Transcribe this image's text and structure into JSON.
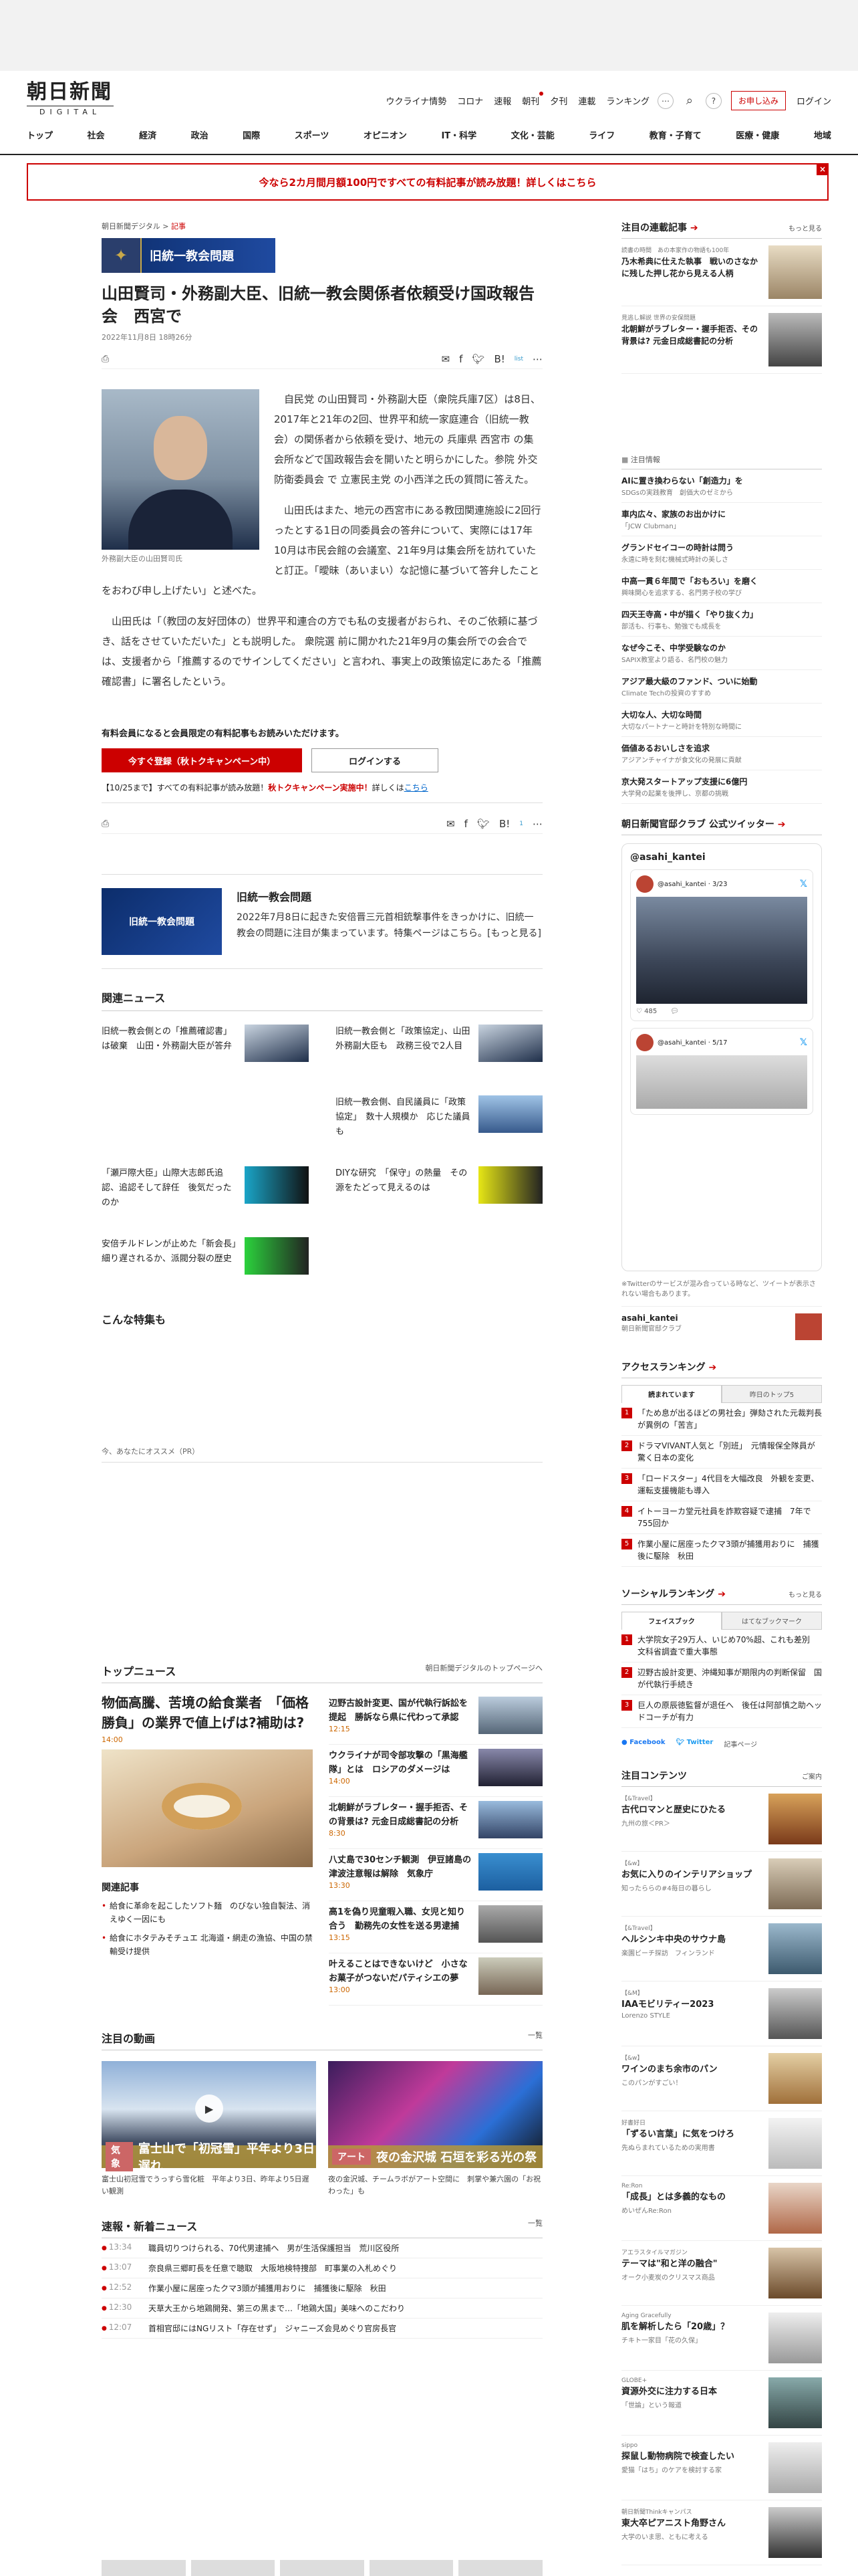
{
  "header": {
    "logo_main": "朝日新聞",
    "logo_sub": "DIGITAL",
    "subnav": [
      "ウクライナ情勢",
      "コロナ",
      "速報",
      "朝刊",
      "夕刊",
      "連載",
      "ランキング"
    ],
    "subscribe": "お申し込み",
    "login": "ログイン",
    "mainnav": [
      "トップ",
      "社会",
      "経済",
      "政治",
      "国際",
      "スポーツ",
      "オピニオン",
      "IT・科学",
      "文化・芸能",
      "ライフ",
      "教育・子育て",
      "医療・健康",
      "地域"
    ]
  },
  "promo": {
    "text": "今なら2カ月間月額100円ですべての有料記事が読み放題！詳しくはこちら",
    "close": "×"
  },
  "article": {
    "crumb_site": "朝日新聞デジタル",
    "crumb_sep": ">",
    "crumb_section": "記事",
    "feature_label": "旧統一教会問題",
    "title": "山田賢司・外務副大臣、旧統一教会関係者依頼受け国政報告会　西宮で",
    "date": "2022年11月8日 18時26分",
    "photo_caption": "外務副大臣の山田賢司氏",
    "paragraphs": [
      "自民党 の山田賢司・外務副大臣（衆院兵庫7区）は8日、2017年と21年の2回、世界平和統一家庭連合（旧統一教会）の関係者から依頼を受け、地元の 兵庫県 西宮市 の集会所などで国政報告会を開いたと明らかにした。参院 外交防衛委員会 で 立憲民主党 の小西洋之氏の質問に答えた。",
      "山田氏はまた、地元の西宮市にある教団関連施設に2回行ったとする1日の同委員会の答弁について、実際には17年10月は市民会館の会議室、21年9月は集会所を訪れていたと訂正。「曖昧（あいまい）な記憶に基づいて答弁したことをおわび申し上げたい」と述べた。",
      "山田氏は「（教団の友好団体の）世界平和連合の方でも私の支援者がおられ、そのご依頼に基づき、話をさせていただいた」とも説明した。 衆院選 前に開かれた21年9月の集会所での会合では、支援者から「推薦するのでサインしてください」と言われ、事実上の政策協定にあたる「推薦確認書」に署名したという。"
    ],
    "paywall_note": "有料会員になると会員限定の有料記事もお読みいただけます。",
    "register_btn": "今すぐ登録（秋トクキャンペーン中）",
    "login_btn": "ログインする",
    "campaign_pre": "【10/25まで】すべての有料記事が読み放題！",
    "campaign_red": "秋トクキャンペーン実施中！",
    "campaign_mid": "詳しくは",
    "campaign_link": "こちら",
    "share_small": "list",
    "share_count": "1"
  },
  "feature_box": {
    "img_label": "旧統一教会問題",
    "title": "旧統一教会問題",
    "text": "2022年7月8日に起きた安倍晋三元首相銃撃事件をきっかけに、旧統一教会の問題に注目が集まっています。特集ページはこちら。[もっと見る]"
  },
  "related": {
    "heading": "関連ニュース",
    "items": [
      "旧統一教会側との「推薦確認書」は破棄　山田・外務副大臣が答弁",
      "旧統一教会側と「政策協定」、山田外務副大臣も　政務三役で2人目",
      "",
      "旧統一教会側、自民議員に「政策協定」　数十人規模か　応じた議員も",
      "「瀬戸際大臣」山際大志郎氏追認、追認そして辞任　後気だったのか",
      "DIYな研究　「保守」の熱量　その源をたどって見えるのは",
      "安倍チルドレンが止めた「新会長」　細り遅されるか、派閥分裂の歴史"
    ]
  },
  "osusume": "今、あなたにオススメ（PR）",
  "special": "こんな特集も",
  "topnews": {
    "heading": "トップニュース",
    "link": "朝日新聞デジタルのトップページへ",
    "lead_title": "物価高騰、苦境の給食業者　「価格勝負」の業界で値上げは?補助は?",
    "lead_time": "14:00",
    "related_h": "関連記事",
    "related": [
      "給食に革命を起こしたソフト麺　のびない独自製法、消えゆく一因にも",
      "給食にホタテみそチュエ 北海道・網走の漁協、中国の禁輸受け提供"
    ],
    "items": [
      {
        "t": "辺野古設計変更、国が代執行訴訟を提起　勝訴なら県に代わって承認",
        "time": "12:15"
      },
      {
        "t": "ウクライナが司令部攻撃の「黒海艦隊」とは　ロシアのダメージは",
        "time": "14:00"
      },
      {
        "t": "北朝鮮がラブレター・握手拒否、その背景は? 元金日成総書記の分析",
        "time": "8:30"
      },
      {
        "t": "八丈島で30センチ観測　伊豆諸島の津波注意報は解除　気象庁",
        "time": "13:30"
      },
      {
        "t": "高1を偽り児童暇入職、女児と知り合う　勤務先の女性を送る男逮捕",
        "time": "13:15"
      },
      {
        "t": "叶えることはできないけど　小さなお菓子がつないだパティシエの夢",
        "time": "13:00"
      }
    ]
  },
  "videos": {
    "heading": "注目の動画",
    "more": "一覧",
    "items": [
      {
        "tag": "気象",
        "label": "富士山で「初冠雪」平年より3日遅れ",
        "cap": "富士山初冠雪でうっすら雪化粧　平年より3日、昨年より5日遅い観測"
      },
      {
        "tag": "アート",
        "label": "夜の金沢城 石垣を彩る光の祭",
        "cap": "夜の金沢城、チームラボがアート空間に　刺掌や兼六園の「お祝わった」も"
      }
    ]
  },
  "flash": {
    "heading": "速報・新着ニュース",
    "more": "一覧",
    "items": [
      {
        "tm": "13:34",
        "t": "職員切りつけられる、70代男逮捕へ　男が生活保護担当　荒川区役所"
      },
      {
        "tm": "13:07",
        "t": "奈良県三郷町長を任意で聴取　大阪地検特捜部　町事業の入札めぐり"
      },
      {
        "tm": "12:52",
        "t": "作業小屋に居座ったクマ3頭が捕獲用おりに　捕獲後に駆除　秋田"
      },
      {
        "tm": "12:30",
        "t": "天草大王から地鶏開発、第三の黒まで…「地鶏大国」美味へのこだわり"
      },
      {
        "tm": "12:07",
        "t": "首相官邸にはNGリスト「存在せず」　ジャニーズ会見めぐり官房長官"
      }
    ]
  },
  "side": {
    "series_h": "注目の連載記事",
    "more": "もっと見る",
    "series": [
      {
        "k": "読書の時間　あの本家作の物語も100年",
        "t": "乃木希典に仕えた執事　戦いのさなかに残した押し花から見える人柄"
      },
      {
        "k": "見逃し解説 世界の安保問題",
        "t": "北朝鮮がラブレター・握手拒否、その背景は? 元金日成総書記の分析"
      }
    ],
    "notice": "注目情報",
    "ads": [
      {
        "t": "AIに置き換わらない「創造力」を",
        "s": "SDGsの実践教育　創価大のゼミから"
      },
      {
        "t": "車内広々、家族のお出かけに",
        "s": "「JCW Clubman」"
      },
      {
        "t": "グランドセイコーの時計は問う",
        "s": "永遠に時を刻む機械式時計の美しさ"
      },
      {
        "t": "中高一貫６年間で「おもろい」を磨く",
        "s": "興味関心を追求する、名門男子校の学び"
      },
      {
        "t": "四天王寺高・中が描く「やり抜く力」",
        "s": "部活も、行事も、勉強でも成長を"
      },
      {
        "t": "なぜ今こそ、中学受験なのか",
        "s": "SAPIX教室より語る、名門校の魅力"
      },
      {
        "t": "アジア最大級のファンド、ついに始動",
        "s": "Climate Techの投資のすすめ"
      },
      {
        "t": "大切な人、大切な時間",
        "s": "大切なパートナーと時計を特別な時間に"
      },
      {
        "t": "価値あるおいしさを追求",
        "s": "アジアンチャイナが食文化の発展に貢献"
      },
      {
        "t": "京大発スタートアップ支援に6億円",
        "s": "大学発の起業を後押し、京都の挑戦"
      }
    ],
    "twitter_h": "朝日新聞官邸クラブ 公式ツイッター",
    "tw_account": "@asahi_kantei",
    "tweet1_handle": "@asahi_kantei · 3/23",
    "tweet1_meta": "485",
    "tweet2_handle": "@asahi_kantei · 5/17",
    "tw_note": "※Twitterのサービスが混み合っている時など、ツイートが表示されない場合もあります。",
    "tw_acc_name": "asahi_kantei",
    "tw_acc_sub": "朝日新聞官邸クラブ",
    "rank_h": "アクセスランキング",
    "rank_tabs": [
      "読まれています",
      "昨日のトップ5"
    ],
    "ranks": [
      "「ため息が出るほどの男社会」弾劾された元裁判長が異例の「苦言」",
      "ドラマVIVANT人気と「別班」　元情報保全隊員が驚く日本の変化",
      "「ロードスター」4代目を大幅改良　外観を変更、運転支援機能も導入",
      "イトーヨーカ堂元社員を詐欺容疑で逮捕　7年で755回か",
      "作業小屋に居座ったクマ3頭が捕獲用おりに　捕獲後に駆除　秋田"
    ],
    "social_h": "ソーシャルランキング",
    "social_tabs": [
      "フェイスブック",
      "はてなブックマーク"
    ],
    "social": [
      "大学院女子29万人、いじめ70%超、これも差別　文科省調査で重大事態",
      "辺野古設計変更、沖縄知事が期限内の判断保留　国が代執行手続き",
      "巨人の原辰徳監督が退任へ　後任は阿部慎之助ヘッドコーチが有力"
    ],
    "social_fb": "Facebook",
    "social_tw": "Twitter",
    "social_more": "記事ページ",
    "contents_h": "注目コンテンツ",
    "contents_more": "ご案内",
    "contents": [
      {
        "k": "【&Travel】",
        "t": "古代ロマンと歴史にひたる",
        "s": "九州の旅＜PR＞"
      },
      {
        "k": "【&w】",
        "t": "お気に入りのインテリアショップ",
        "s": "知ったららの#4毎日の暮らし"
      },
      {
        "k": "【&Travel】",
        "t": "ヘルシンキ中央のサウナ島",
        "s": "楽園ビーチ探訪　フィンランド"
      },
      {
        "k": "【&M】",
        "t": "IAAモビリティー2023",
        "s": "Lorenzo STYLE"
      },
      {
        "k": "【&w】",
        "t": "ワインのまち余市のパン",
        "s": "このパンがすごい！"
      },
      {
        "k": "好書好日",
        "t": "「ずるい言葉」に気をつけろ",
        "s": "先ぬらまれているための実用書"
      },
      {
        "k": "Re:Ron",
        "t": "「成長」とは多義的なもの",
        "s": "めいぜんRe:Ron"
      },
      {
        "k": "アエラスタイルマガジン",
        "t": "テーマは\"和と洋の融合\"",
        "s": "オーク小麦炭のクリスマス商品"
      },
      {
        "k": "Aging Gracefully",
        "t": "肌を解析したら「20歳」？",
        "s": "チキト一家目「花の久保」"
      },
      {
        "k": "GLOBE+",
        "t": "資源外交に注力する日本",
        "s": "「世論」という報道"
      },
      {
        "k": "sippo",
        "t": "探鼠し動物病院で検査したい",
        "s": "愛猫「はち」のケアを検討する家"
      },
      {
        "k": "朝日新聞Thinkキャンパス",
        "t": "東大卒ピアニスト角野さん",
        "s": "大学のいま思、ともに考える"
      }
    ]
  },
  "colors": {
    "accent": "#cc0000",
    "brand_blue": "#1f4aa0"
  }
}
